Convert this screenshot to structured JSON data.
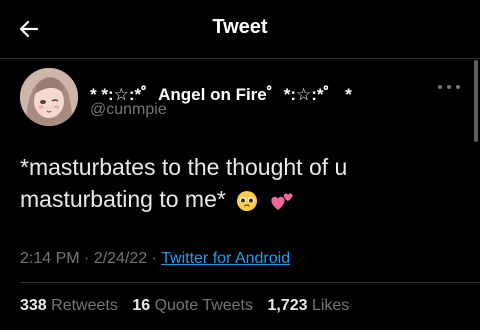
{
  "header": {
    "title": "Tweet",
    "back_icon": "arrow-left-icon"
  },
  "author": {
    "display_name": "* *:☆:*゜Angel on Fire゜*:☆:*゜ *",
    "username": "@cunmpie"
  },
  "tweet": {
    "text": "*masturbates to the thought of u masturbating to me*",
    "emojis": [
      "pleading-face-icon",
      "two-hearts-icon"
    ]
  },
  "meta": {
    "time": "2:14 PM",
    "date": "2/24/22",
    "separator": " · ",
    "source": "Twitter for Android"
  },
  "stats": {
    "retweets_count": "338",
    "retweets_label": "Retweets",
    "quotes_count": "16",
    "quotes_label": "Quote Tweets",
    "likes_count": "1,723",
    "likes_label": "Likes"
  },
  "colors": {
    "background": "#000000",
    "accent": "#1d9bf0",
    "secondary_text": "#71767b"
  }
}
